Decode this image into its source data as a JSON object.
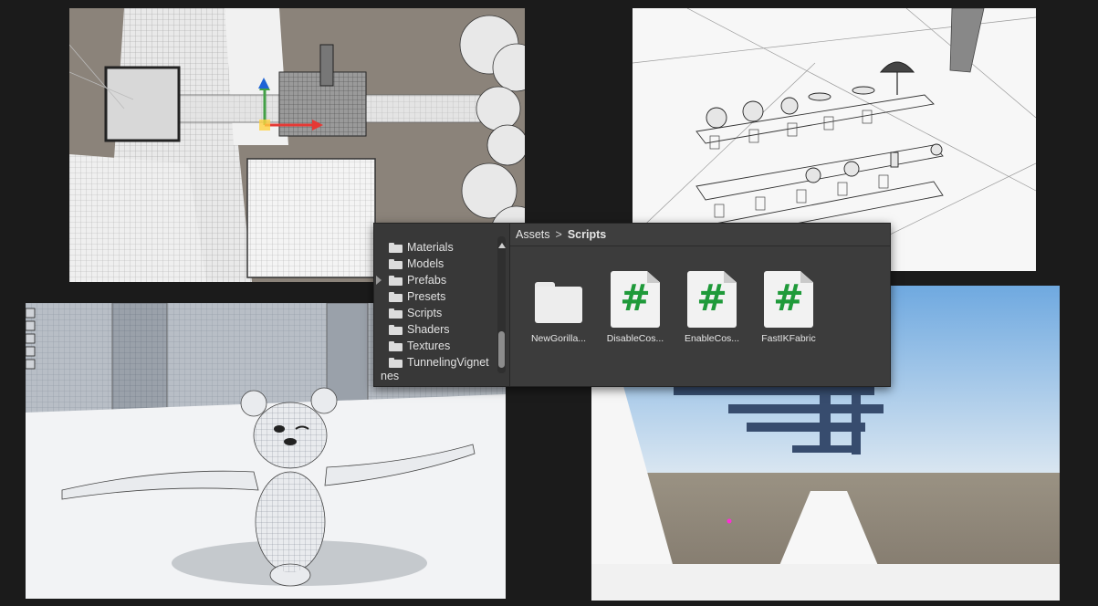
{
  "project": {
    "folders": [
      "Materials",
      "Models",
      "Prefabs",
      "Presets",
      "Scripts",
      "Shaders",
      "Textures",
      "TunnelingVignet"
    ],
    "partial_item": "nes",
    "breadcrumb": {
      "root": "Assets",
      "separator": ">",
      "current": "Scripts"
    },
    "assets": [
      {
        "type": "folder",
        "icon": "folder-icon",
        "label": "NewGorilla..."
      },
      {
        "type": "script",
        "icon": "csharp-script-icon",
        "glyph": "#",
        "label": "DisableCos..."
      },
      {
        "type": "script",
        "icon": "csharp-script-icon",
        "glyph": "#",
        "label": "EnableCos..."
      },
      {
        "type": "script",
        "icon": "csharp-script-icon",
        "glyph": "#",
        "label": "FastIKFabric"
      }
    ]
  },
  "colors": {
    "script_hash": "#1f9a3a",
    "panel_bg": "#3c3c3c",
    "panel_text": "#e6e6e6",
    "gizmo_x": "#e53935",
    "gizmo_y": "#43a047",
    "gizmo_z": "#1e63d6",
    "magenta_dot": "#ff2bd6"
  }
}
